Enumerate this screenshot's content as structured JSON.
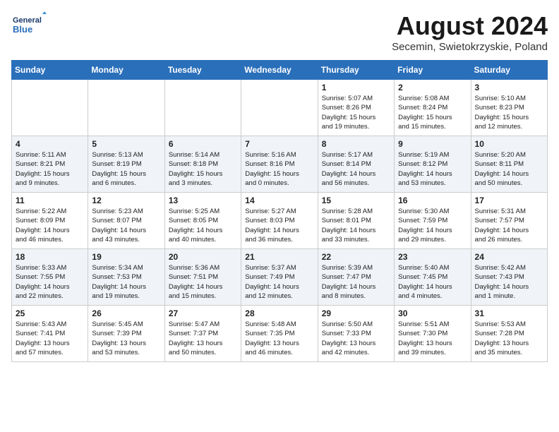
{
  "header": {
    "logo_line1": "General",
    "logo_line2": "Blue",
    "month_year": "August 2024",
    "location": "Secemin, Swietokrzyskie, Poland"
  },
  "weekdays": [
    "Sunday",
    "Monday",
    "Tuesday",
    "Wednesday",
    "Thursday",
    "Friday",
    "Saturday"
  ],
  "weeks": [
    [
      {
        "day": "",
        "info": ""
      },
      {
        "day": "",
        "info": ""
      },
      {
        "day": "",
        "info": ""
      },
      {
        "day": "",
        "info": ""
      },
      {
        "day": "1",
        "info": "Sunrise: 5:07 AM\nSunset: 8:26 PM\nDaylight: 15 hours\nand 19 minutes."
      },
      {
        "day": "2",
        "info": "Sunrise: 5:08 AM\nSunset: 8:24 PM\nDaylight: 15 hours\nand 15 minutes."
      },
      {
        "day": "3",
        "info": "Sunrise: 5:10 AM\nSunset: 8:23 PM\nDaylight: 15 hours\nand 12 minutes."
      }
    ],
    [
      {
        "day": "4",
        "info": "Sunrise: 5:11 AM\nSunset: 8:21 PM\nDaylight: 15 hours\nand 9 minutes."
      },
      {
        "day": "5",
        "info": "Sunrise: 5:13 AM\nSunset: 8:19 PM\nDaylight: 15 hours\nand 6 minutes."
      },
      {
        "day": "6",
        "info": "Sunrise: 5:14 AM\nSunset: 8:18 PM\nDaylight: 15 hours\nand 3 minutes."
      },
      {
        "day": "7",
        "info": "Sunrise: 5:16 AM\nSunset: 8:16 PM\nDaylight: 15 hours\nand 0 minutes."
      },
      {
        "day": "8",
        "info": "Sunrise: 5:17 AM\nSunset: 8:14 PM\nDaylight: 14 hours\nand 56 minutes."
      },
      {
        "day": "9",
        "info": "Sunrise: 5:19 AM\nSunset: 8:12 PM\nDaylight: 14 hours\nand 53 minutes."
      },
      {
        "day": "10",
        "info": "Sunrise: 5:20 AM\nSunset: 8:11 PM\nDaylight: 14 hours\nand 50 minutes."
      }
    ],
    [
      {
        "day": "11",
        "info": "Sunrise: 5:22 AM\nSunset: 8:09 PM\nDaylight: 14 hours\nand 46 minutes."
      },
      {
        "day": "12",
        "info": "Sunrise: 5:23 AM\nSunset: 8:07 PM\nDaylight: 14 hours\nand 43 minutes."
      },
      {
        "day": "13",
        "info": "Sunrise: 5:25 AM\nSunset: 8:05 PM\nDaylight: 14 hours\nand 40 minutes."
      },
      {
        "day": "14",
        "info": "Sunrise: 5:27 AM\nSunset: 8:03 PM\nDaylight: 14 hours\nand 36 minutes."
      },
      {
        "day": "15",
        "info": "Sunrise: 5:28 AM\nSunset: 8:01 PM\nDaylight: 14 hours\nand 33 minutes."
      },
      {
        "day": "16",
        "info": "Sunrise: 5:30 AM\nSunset: 7:59 PM\nDaylight: 14 hours\nand 29 minutes."
      },
      {
        "day": "17",
        "info": "Sunrise: 5:31 AM\nSunset: 7:57 PM\nDaylight: 14 hours\nand 26 minutes."
      }
    ],
    [
      {
        "day": "18",
        "info": "Sunrise: 5:33 AM\nSunset: 7:55 PM\nDaylight: 14 hours\nand 22 minutes."
      },
      {
        "day": "19",
        "info": "Sunrise: 5:34 AM\nSunset: 7:53 PM\nDaylight: 14 hours\nand 19 minutes."
      },
      {
        "day": "20",
        "info": "Sunrise: 5:36 AM\nSunset: 7:51 PM\nDaylight: 14 hours\nand 15 minutes."
      },
      {
        "day": "21",
        "info": "Sunrise: 5:37 AM\nSunset: 7:49 PM\nDaylight: 14 hours\nand 12 minutes."
      },
      {
        "day": "22",
        "info": "Sunrise: 5:39 AM\nSunset: 7:47 PM\nDaylight: 14 hours\nand 8 minutes."
      },
      {
        "day": "23",
        "info": "Sunrise: 5:40 AM\nSunset: 7:45 PM\nDaylight: 14 hours\nand 4 minutes."
      },
      {
        "day": "24",
        "info": "Sunrise: 5:42 AM\nSunset: 7:43 PM\nDaylight: 14 hours\nand 1 minute."
      }
    ],
    [
      {
        "day": "25",
        "info": "Sunrise: 5:43 AM\nSunset: 7:41 PM\nDaylight: 13 hours\nand 57 minutes."
      },
      {
        "day": "26",
        "info": "Sunrise: 5:45 AM\nSunset: 7:39 PM\nDaylight: 13 hours\nand 53 minutes."
      },
      {
        "day": "27",
        "info": "Sunrise: 5:47 AM\nSunset: 7:37 PM\nDaylight: 13 hours\nand 50 minutes."
      },
      {
        "day": "28",
        "info": "Sunrise: 5:48 AM\nSunset: 7:35 PM\nDaylight: 13 hours\nand 46 minutes."
      },
      {
        "day": "29",
        "info": "Sunrise: 5:50 AM\nSunset: 7:33 PM\nDaylight: 13 hours\nand 42 minutes."
      },
      {
        "day": "30",
        "info": "Sunrise: 5:51 AM\nSunset: 7:30 PM\nDaylight: 13 hours\nand 39 minutes."
      },
      {
        "day": "31",
        "info": "Sunrise: 5:53 AM\nSunset: 7:28 PM\nDaylight: 13 hours\nand 35 minutes."
      }
    ]
  ]
}
